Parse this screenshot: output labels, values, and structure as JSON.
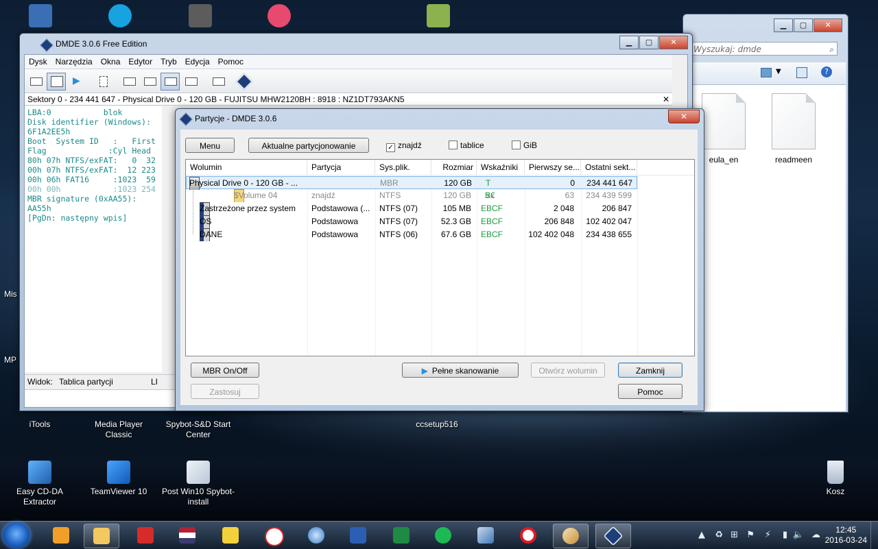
{
  "desktop": {
    "left_labels": [
      "Mis",
      "MP"
    ],
    "icons_row1": [
      {
        "label": "iTools"
      },
      {
        "label": "Media Player Classic"
      },
      {
        "label": "Spybot-S&D Start Center"
      },
      {
        "label": "ccsetup516"
      }
    ],
    "icons_row2": [
      {
        "label": "Easy CD-DA Extractor"
      },
      {
        "label": "TeamViewer 10"
      },
      {
        "label": "Post Win10 Spybot-install"
      },
      {
        "label": "Kosz"
      }
    ]
  },
  "explorer": {
    "search_placeholder": "Wyszukaj: dmde",
    "files": [
      "eula_en",
      "readmeen"
    ]
  },
  "dmde": {
    "title": "DMDE 3.0.6 Free Edition",
    "menu": [
      "Dysk",
      "Narzędzia",
      "Okna",
      "Edytor",
      "Tryb",
      "Edycja",
      "Pomoc"
    ],
    "path": "Sektory 0 - 234 441 647 - Physical Drive 0 - 120 GB - FUJITSU MHW2120BH : 8918 : NZ1DT793AKN5",
    "close_glyph": "✕",
    "hex_lines": [
      "LBA:0           blok",
      "Disk identifier (Windows):",
      "6F1A2EE5h",
      "Boot  System ID   :   First",
      "Flag             :Cyl Head",
      "80h 07h NTFS/exFAT:   0  32",
      "00h 07h NTFS/exFAT:  12 223",
      "00h 06h FAT16     :1023  59",
      "00h 00h           :1023 254",
      "MBR signature (0xAA55):",
      "AA55h",
      "[PgDn: następny wpis]"
    ],
    "status_label": "Widok:",
    "status_value": "Tablica partycji",
    "status_extra": "LI"
  },
  "dialog": {
    "title": "Partycje - DMDE 3.0.6",
    "menu_button": "Menu",
    "current_button": "Aktualne partycjonowanie",
    "checkboxes": [
      {
        "label": "znajdź",
        "checked": true
      },
      {
        "label": "tablice",
        "checked": false
      },
      {
        "label": "GiB",
        "checked": false
      }
    ],
    "columns": [
      "Wolumin",
      "Partycja",
      "Sys.plik.",
      "Rozmiar",
      "Wskaźniki",
      "Pierwszy se...",
      "Ostatni sekt..."
    ],
    "rows": [
      {
        "volume": "Physical Drive 0 - 120 GB - ...",
        "partition": "",
        "fs": "MBR",
        "size": "120 GB",
        "flags": "T",
        "first": "0",
        "last": "234 441 647"
      },
      {
        "volume": "$Volume 04",
        "partition": "znajdź",
        "fs": "NTFS",
        "size": "120 GB",
        "flags": "BC",
        "flags_extra": "xx",
        "first": "63",
        "last": "234 439 599"
      },
      {
        "volume": "Zastrzeżone przez system",
        "partition": "Podstawowa (...",
        "fs": "NTFS (07)",
        "size": "105 MB",
        "flags": "EBCF",
        "first": "2 048",
        "last": "206 847"
      },
      {
        "volume": "OS",
        "partition": "Podstawowa",
        "fs": "NTFS (07)",
        "size": "52.3 GB",
        "flags": "EBCF",
        "first": "206 848",
        "last": "102 402 047"
      },
      {
        "volume": "DANE",
        "partition": "Podstawowa",
        "fs": "NTFS (06)",
        "size": "67.6 GB",
        "flags": "EBCF",
        "first": "102 402 048",
        "last": "234 438 655"
      }
    ],
    "mbr_button": "MBR On/Off",
    "apply_button": "Zastosuj",
    "scan_button": "Pełne skanowanie",
    "open_volume_button": "Otwórz wolumin",
    "close_button": "Zamknij",
    "help_button": "Pomoc"
  },
  "taskbar": {
    "time": "12:45",
    "date": "2016-03-24"
  },
  "colors": {
    "flag_green": "#1b9a3a",
    "hex_teal": "#1c8a8a",
    "selection": "#e5f0fb"
  }
}
